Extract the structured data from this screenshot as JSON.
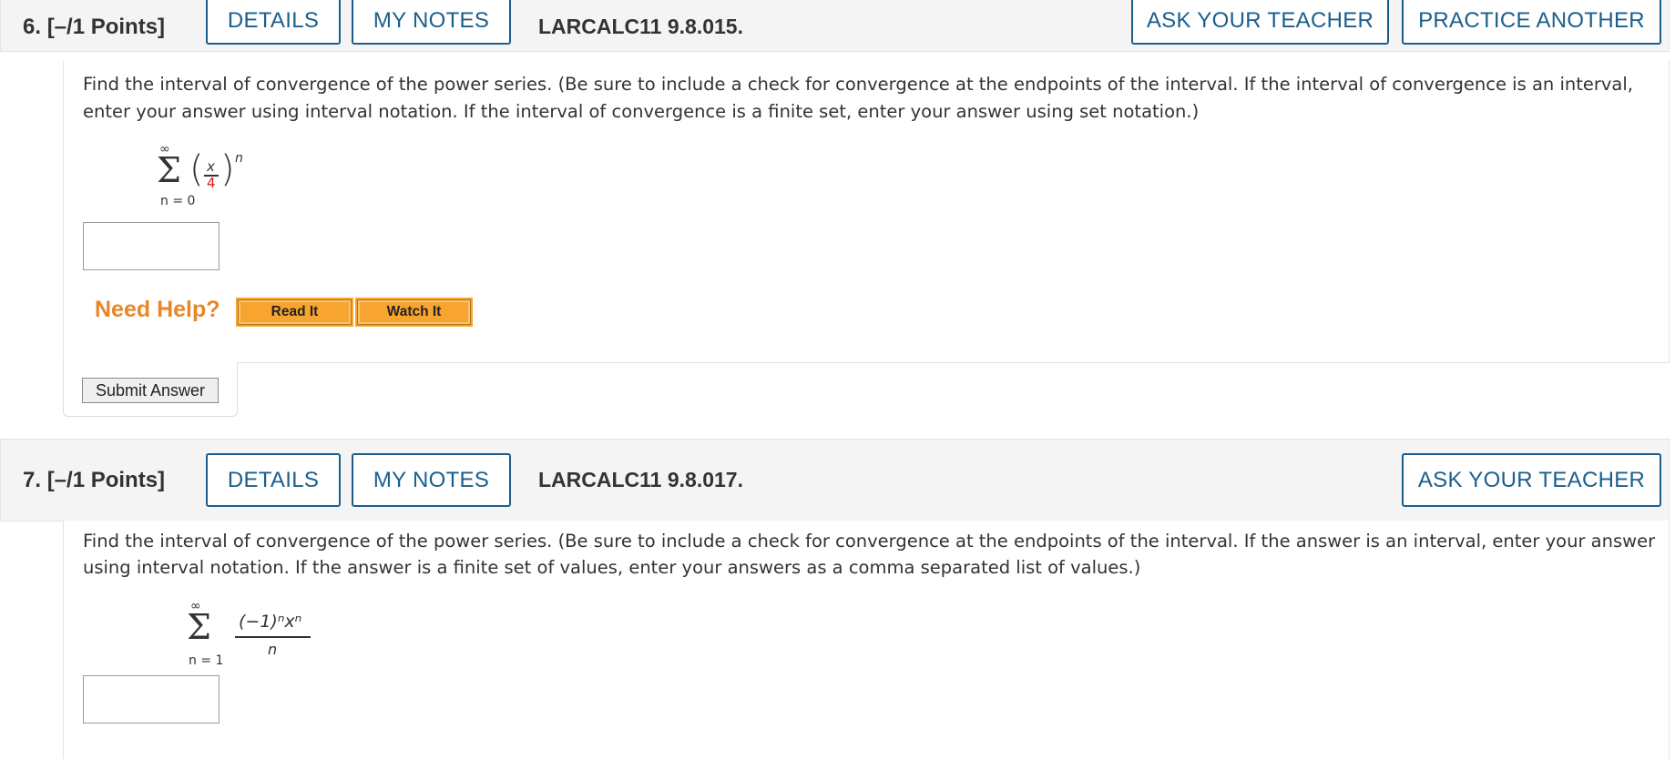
{
  "q6": {
    "number": "6.",
    "points": "[–/1 Points]",
    "details": "DETAILS",
    "my_notes": "MY NOTES",
    "code": "LARCALC11 9.8.015.",
    "ask_teacher": "ASK YOUR TEACHER",
    "practice_another": "PRACTICE ANOTHER",
    "prompt": "Find the interval of convergence of the power series. (Be sure to include a check for convergence at the endpoints of the interval. If the interval of convergence is an interval, enter your answer using interval notation. If the interval of convergence is a finite set, enter your answer using set notation.)",
    "series": {
      "upper": "∞",
      "lower": "n = 0",
      "numerator": "x",
      "denominator": "4",
      "exponent": "n",
      "denominator_color": "#e01818"
    },
    "answer_value": "",
    "need_help": "Need Help?",
    "read_it": "Read It",
    "watch_it": "Watch It",
    "submit": "Submit Answer"
  },
  "q7": {
    "number": "7.",
    "points": "[–/1 Points]",
    "details": "DETAILS",
    "my_notes": "MY NOTES",
    "code": "LARCALC11 9.8.017.",
    "ask_teacher": "ASK YOUR TEACHER",
    "prompt": "Find the interval of convergence of the power series. (Be sure to include a check for convergence at the endpoints of the interval. If the answer is an interval, enter your answer using interval notation. If the answer is a finite set of values, enter your answers as a comma separated list of values.)",
    "series": {
      "upper": "∞",
      "lower": "n = 1",
      "numerator": "(−1)ⁿxⁿ",
      "denominator": "n"
    },
    "answer_value": ""
  },
  "colors": {
    "accent_blue": "#1b5e8c",
    "help_orange": "#e8862a",
    "button_orange": "#f7a530"
  }
}
